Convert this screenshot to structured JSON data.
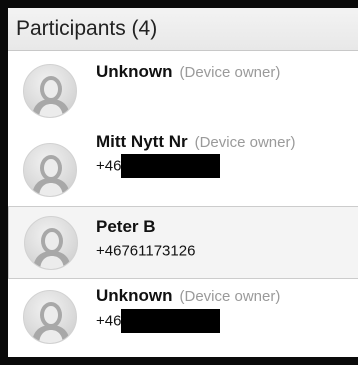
{
  "panel": {
    "title": "Participants (4)"
  },
  "participants": [
    {
      "name": "Unknown",
      "tag": "(Device owner)",
      "phone": "",
      "redacted": false
    },
    {
      "name": "Mitt Nytt Nr",
      "tag": "(Device owner)",
      "phone": "+46",
      "redacted": true
    },
    {
      "name": "Peter B",
      "tag": "",
      "phone": "+46761173126",
      "redacted": false
    },
    {
      "name": "Unknown",
      "tag": "(Device owner)",
      "phone": "+46",
      "redacted": true
    }
  ],
  "icons": {
    "avatar": "default-user-avatar-icon"
  },
  "colors": {
    "frame": "#0a0a0a",
    "header_bg": "#e8e8e8",
    "selected_row_bg": "#f4f4f4",
    "tag_text": "#9a9a9a",
    "redaction": "#000000"
  }
}
